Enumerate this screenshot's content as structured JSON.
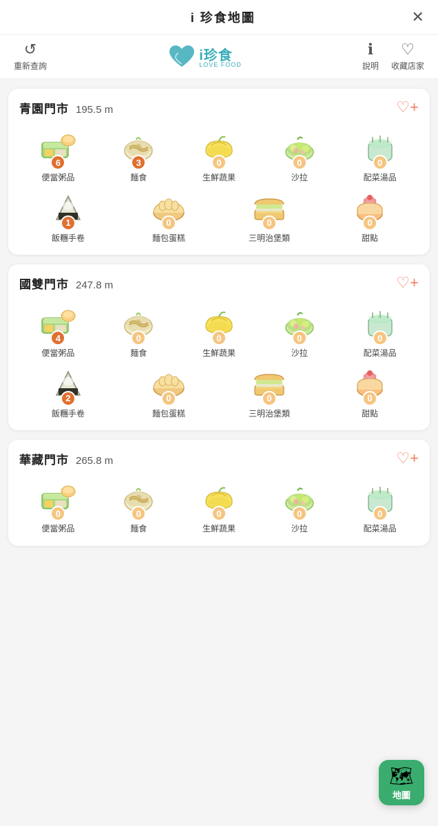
{
  "titleBar": {
    "title": "i 珍食地圖",
    "closeLabel": "✕"
  },
  "navBar": {
    "refreshLabel": "重新查詢",
    "logoText": "i珍食",
    "logoSub": "LOVE FOOD",
    "helpLabel": "說明",
    "favoriteLabel": "收藏店家"
  },
  "stores": [
    {
      "name": "青園門市",
      "distance": "195.5 m",
      "categories": [
        {
          "label": "便當粥品",
          "count": 6,
          "highlight": true
        },
        {
          "label": "麵食",
          "count": 3,
          "highlight": true
        },
        {
          "label": "生鮮蔬果",
          "count": 0
        },
        {
          "label": "沙拉",
          "count": 0
        },
        {
          "label": "配菜湯品",
          "count": 0
        }
      ],
      "categories2": [
        {
          "label": "飯糰手卷",
          "count": 1,
          "highlight": true
        },
        {
          "label": "麵包蛋糕",
          "count": 0
        },
        {
          "label": "三明治堡類",
          "count": 0
        },
        {
          "label": "甜點",
          "count": 0
        }
      ]
    },
    {
      "name": "國雙門市",
      "distance": "247.8 m",
      "categories": [
        {
          "label": "便當粥品",
          "count": 4,
          "highlight": true
        },
        {
          "label": "麵食",
          "count": 0
        },
        {
          "label": "生鮮蔬果",
          "count": 0
        },
        {
          "label": "沙拉",
          "count": 0
        },
        {
          "label": "配菜湯品",
          "count": 0
        }
      ],
      "categories2": [
        {
          "label": "飯糰手卷",
          "count": 2,
          "highlight": true
        },
        {
          "label": "麵包蛋糕",
          "count": 0
        },
        {
          "label": "三明治堡類",
          "count": 0
        },
        {
          "label": "甜點",
          "count": 0
        }
      ]
    },
    {
      "name": "華藏門市",
      "distance": "265.8 m",
      "categories": [
        {
          "label": "便當粥品",
          "count": 0
        },
        {
          "label": "麵食",
          "count": 0
        },
        {
          "label": "生鮮蔬果",
          "count": 0
        },
        {
          "label": "沙拉",
          "count": 0
        },
        {
          "label": "配菜湯品",
          "count": 0
        }
      ],
      "categories2": []
    }
  ],
  "mapFab": {
    "label": "地圖"
  }
}
